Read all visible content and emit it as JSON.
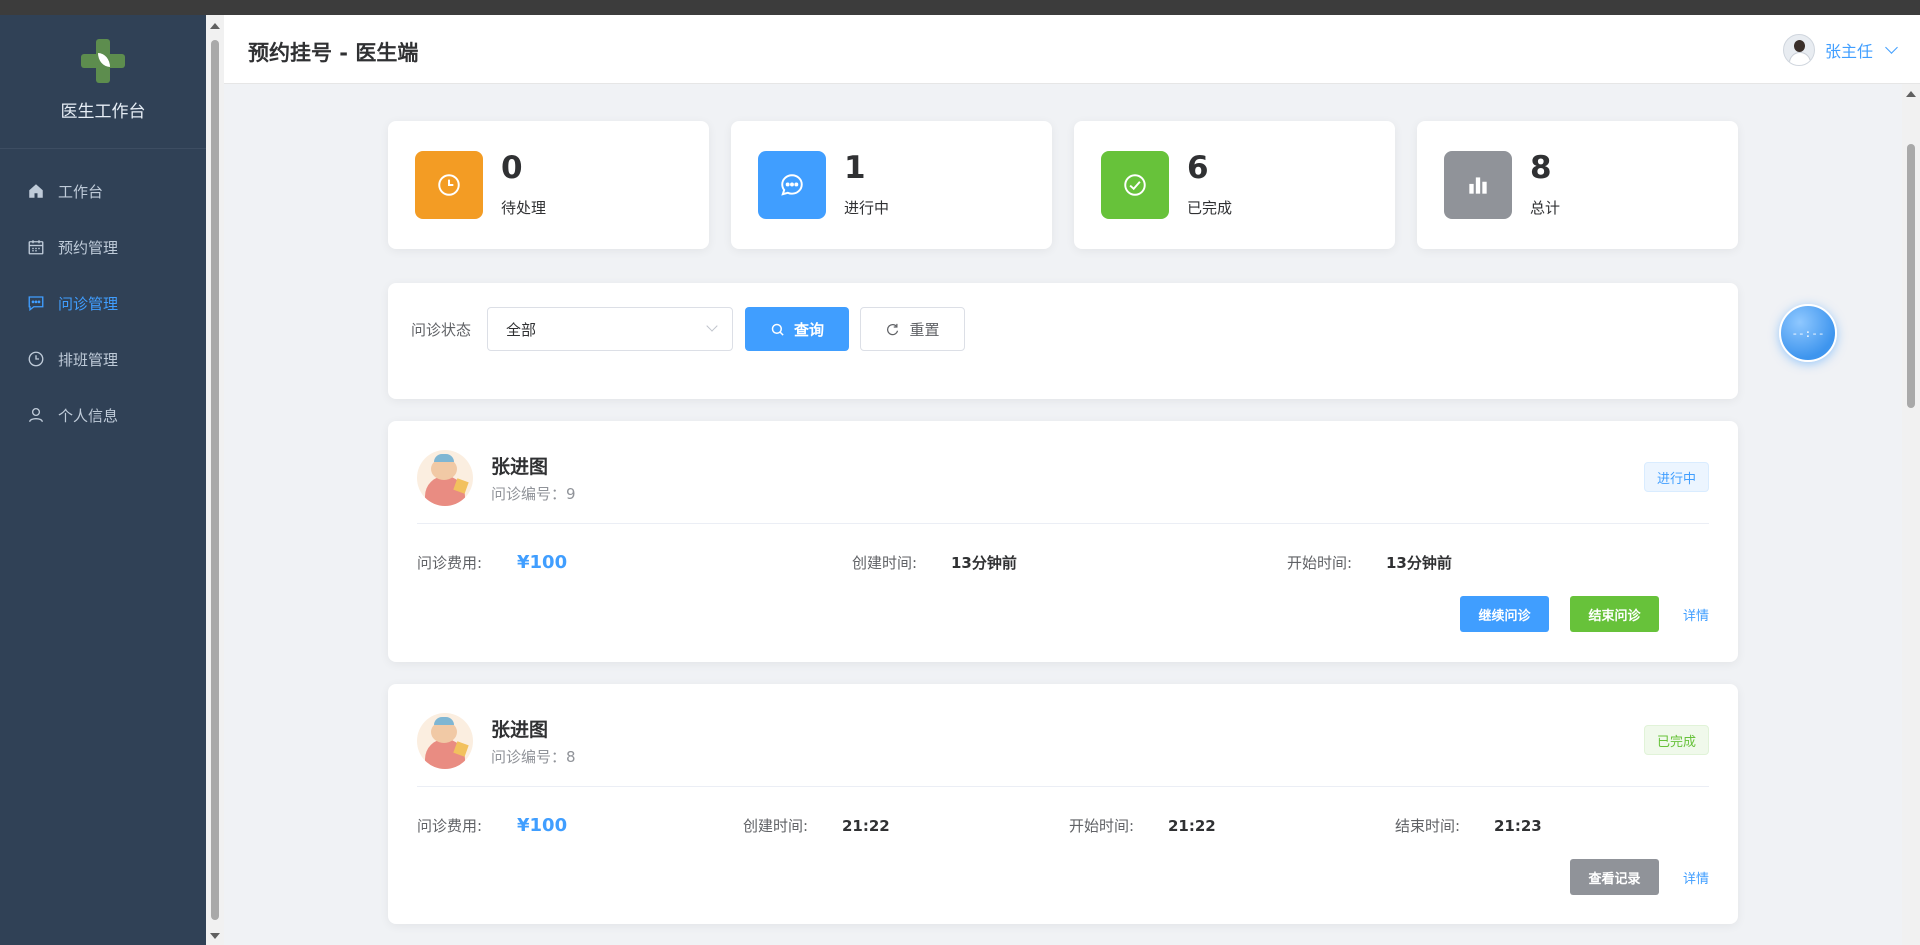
{
  "sidebar": {
    "brand_title": "医生工作台",
    "items": [
      {
        "label": "工作台",
        "icon": "home-icon",
        "active": false
      },
      {
        "label": "预约管理",
        "icon": "calendar-icon",
        "active": false
      },
      {
        "label": "问诊管理",
        "icon": "chat-icon",
        "active": true
      },
      {
        "label": "排班管理",
        "icon": "clock-icon",
        "active": false
      },
      {
        "label": "个人信息",
        "icon": "user-icon",
        "active": false
      }
    ]
  },
  "header": {
    "title": "预约挂号 - 医生端",
    "user_name": "张主任"
  },
  "stats": [
    {
      "value": "0",
      "label": "待处理",
      "color": "#f39c24",
      "icon": "clock-icon"
    },
    {
      "value": "1",
      "label": "进行中",
      "color": "#409eff",
      "icon": "chat-icon"
    },
    {
      "value": "6",
      "label": "已完成",
      "color": "#67c23a",
      "icon": "check-circle-icon"
    },
    {
      "value": "8",
      "label": "总计",
      "color": "#909399",
      "icon": "bar-chart-icon"
    }
  ],
  "filter": {
    "label": "问诊状态",
    "select_value": "全部",
    "query_label": "查询",
    "reset_label": "重置"
  },
  "float_clock": "--:--",
  "consultations": [
    {
      "patient_name": "张进图",
      "number_label": "问诊编号：9",
      "status": "进行中",
      "fee_label": "问诊费用:",
      "fee": "¥100",
      "created_label": "创建时间:",
      "created": "13分钟前",
      "started_label": "开始时间:",
      "started": "13分钟前",
      "actions": [
        "继续问诊",
        "结束问诊"
      ],
      "detail_label": "详情"
    },
    {
      "patient_name": "张进图",
      "number_label": "问诊编号：8",
      "status": "已完成",
      "fee_label": "问诊费用:",
      "fee": "¥100",
      "created_label": "创建时间:",
      "created": "21:22",
      "started_label": "开始时间:",
      "started": "21:22",
      "ended_label": "结束时间:",
      "ended": "21:23",
      "actions": [
        "查看记录"
      ],
      "detail_label": "详情"
    }
  ],
  "colors": {
    "sidebar_bg": "#304156",
    "accent": "#409eff",
    "success": "#67c23a",
    "warning": "#f39c24",
    "neutral": "#909399"
  }
}
